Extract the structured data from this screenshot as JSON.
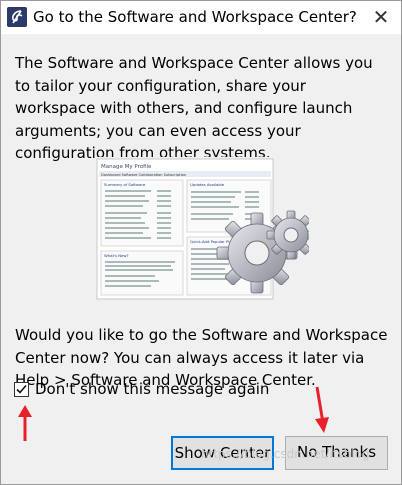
{
  "window": {
    "title": "Go to the Software and Workspace Center?",
    "close_glyph": "✕"
  },
  "body": {
    "intro": "The Software and Workspace Center allows you to tailor your configuration, share your workspace with others, and configure launch arguments; you can even access your configuration from other systems.",
    "question": "Would you like to go the Software and Workspace Center now?  You can always access it later via Help > Software and Workspace Center."
  },
  "checkbox": {
    "label": "Don't show this message again",
    "checked": true
  },
  "buttons": {
    "show_center": "Show Center",
    "no_thanks": "No Thanks"
  },
  "illustration": {
    "header": "Manage My Profile",
    "tabs": "Dashboard  Software  Collaboration  Subscription",
    "summary": "Summary of Software",
    "updates": "Updates Available",
    "whats_new": "What's New?",
    "quick_add": "Quick-Add Popular Plug-ins"
  },
  "watermark": "https://blog.csdn.net/itsblog",
  "colors": {
    "accent": "#0078d7",
    "annotation_arrow": "#e8202a",
    "window_bg": "#f0f0f0"
  }
}
